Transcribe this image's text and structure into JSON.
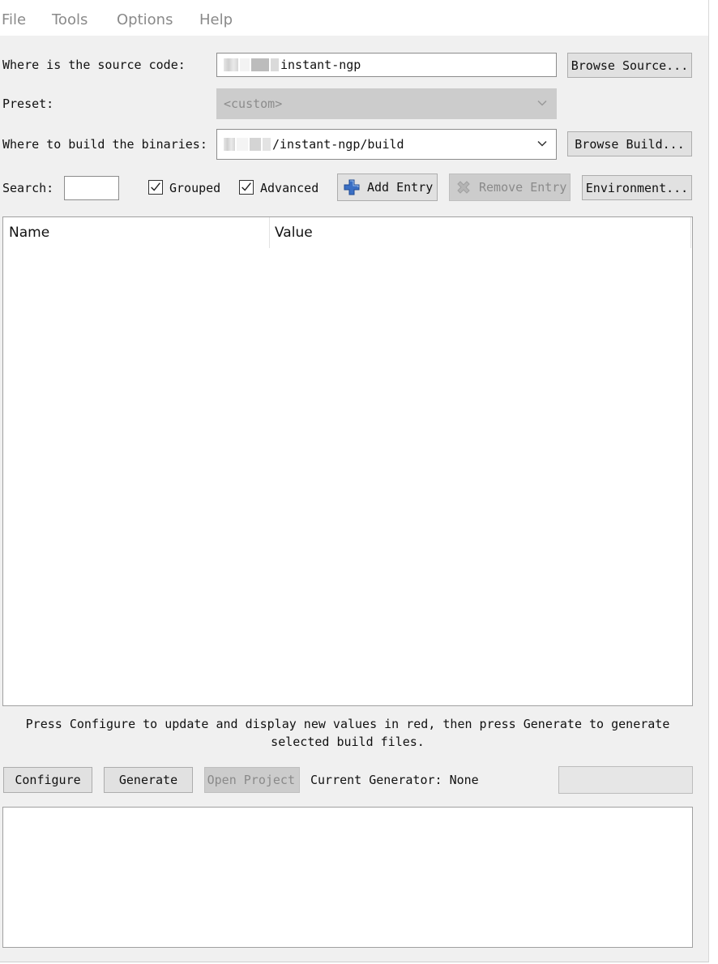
{
  "menu": [
    "File",
    "Tools",
    "Options",
    "Help"
  ],
  "source": {
    "label": "Where is the source code:",
    "path_suffix": "instant-ngp",
    "browse_label": "Browse Source..."
  },
  "preset": {
    "label": "Preset:",
    "value": "<custom>"
  },
  "build": {
    "label": "Where to build the binaries:",
    "path_suffix": "/instant-ngp/build",
    "browse_label": "Browse Build..."
  },
  "toolbar": {
    "search_label": "Search:",
    "search_value": "",
    "grouped_label": "Grouped",
    "grouped_checked": true,
    "advanced_label": "Advanced",
    "advanced_checked": true,
    "add_entry_label": "Add Entry",
    "remove_entry_label": "Remove Entry",
    "environment_label": "Environment..."
  },
  "table": {
    "columns": [
      "Name",
      "Value"
    ],
    "rows": []
  },
  "hint": {
    "line1": "Press Configure to update and display new values in red, then press Generate to generate",
    "line2": "selected build files."
  },
  "actions": {
    "configure_label": "Configure",
    "generate_label": "Generate",
    "open_project_label": "Open Project",
    "current_generator_label": "Current Generator: None"
  },
  "colors": {
    "window_bg": "#f0f0f0",
    "button_bg": "#e1e1e1",
    "disabled_bg": "#cccccc",
    "add_icon": "#3a6fc4"
  }
}
